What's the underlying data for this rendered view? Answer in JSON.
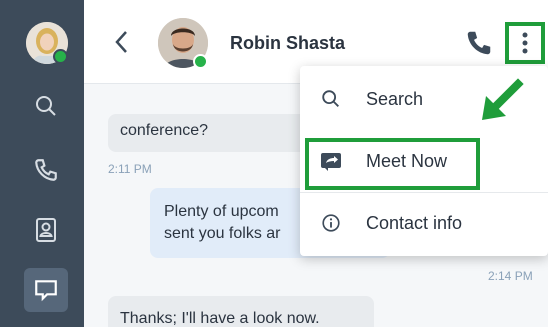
{
  "contact": {
    "name": "Robin Shasta"
  },
  "messages": [
    {
      "text": "conference?",
      "direction": "in"
    },
    {
      "time": "2:11 PM"
    },
    {
      "line1": "Plenty of upcom",
      "line2": "sent you folks ar",
      "direction": "out"
    },
    {
      "time": "2:14 PM"
    },
    {
      "text": "Thanks; I'll have a look now.",
      "direction": "in"
    }
  ],
  "menu": {
    "items": [
      {
        "label": "Search",
        "icon": "search-icon"
      },
      {
        "label": "Meet Now",
        "icon": "meet-now-icon"
      },
      {
        "label": "Contact info",
        "icon": "info-icon"
      }
    ]
  },
  "colors": {
    "sidebar": "#3d4b5a",
    "highlight": "#1f9d3a",
    "presence": "#27b24a",
    "bubble_out": "#e1ecf9"
  }
}
